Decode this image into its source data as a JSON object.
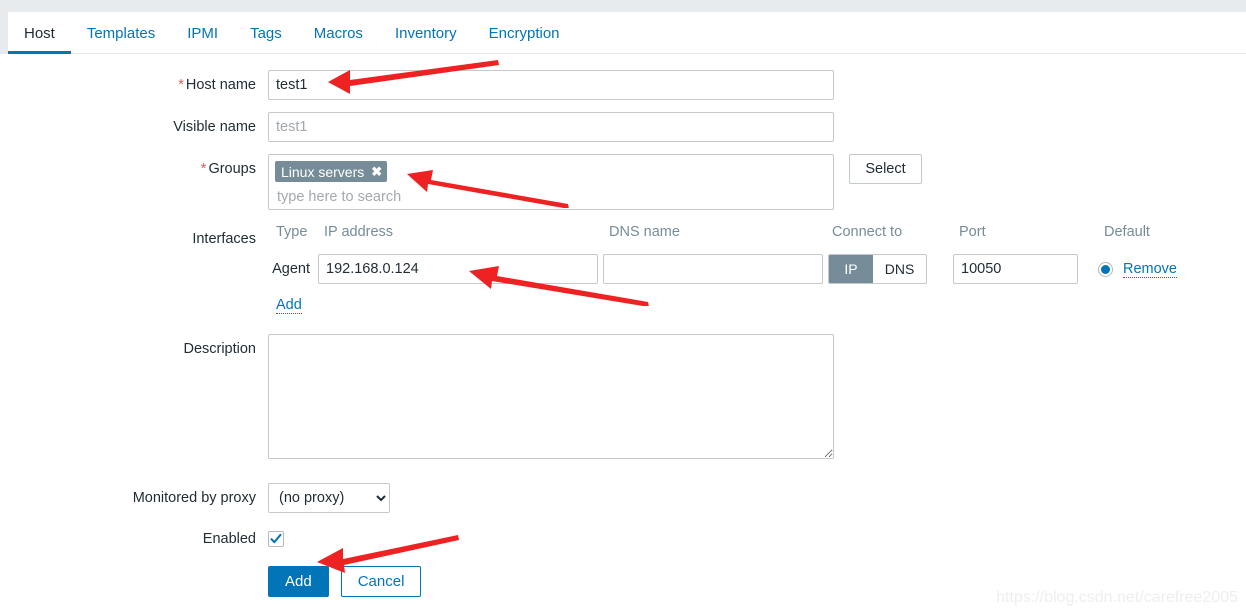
{
  "window": {
    "tabs": [
      {
        "label": "Host",
        "active": true
      },
      {
        "label": "Templates",
        "active": false
      },
      {
        "label": "IPMI",
        "active": false
      },
      {
        "label": "Tags",
        "active": false
      },
      {
        "label": "Macros",
        "active": false
      },
      {
        "label": "Inventory",
        "active": false
      },
      {
        "label": "Encryption",
        "active": false
      }
    ]
  },
  "form": {
    "host_name": {
      "label": "Host name",
      "required": "*",
      "value": "test1",
      "placeholder": ""
    },
    "visible_name": {
      "label": "Visible name",
      "value": "",
      "placeholder": "test1"
    },
    "groups": {
      "label": "Groups",
      "required": "*",
      "chips": [
        {
          "label": "Linux servers",
          "remove_glyph": "✖"
        }
      ],
      "search_placeholder": "type here to search",
      "select_button": "Select"
    },
    "interfaces": {
      "label": "Interfaces",
      "columns": [
        "Type",
        "IP address",
        "DNS name",
        "Connect to",
        "Port",
        "Default"
      ],
      "rows": [
        {
          "type": "Agent",
          "ip": "192.168.0.124",
          "dns": "",
          "connect_to": {
            "options": [
              "IP",
              "DNS"
            ],
            "selected": "IP"
          },
          "port": "10050",
          "default_selected": true,
          "remove_label": "Remove"
        }
      ],
      "add_link": "Add"
    },
    "description": {
      "label": "Description",
      "value": "",
      "placeholder": ""
    },
    "proxy": {
      "label": "Monitored by proxy",
      "selected": "(no proxy)",
      "options": [
        "(no proxy)"
      ]
    },
    "enabled": {
      "label": "Enabled",
      "checked": true
    },
    "actions": {
      "submit": "Add",
      "cancel": "Cancel"
    }
  },
  "watermark": {
    "text": "https://blog.csdn.net/carefree2005"
  },
  "colors": {
    "accent": "#0275b8",
    "chip_bg": "#768d99",
    "required": "#d75f5f",
    "arrow": "#ee2222",
    "chrome": "#e8ebee"
  }
}
